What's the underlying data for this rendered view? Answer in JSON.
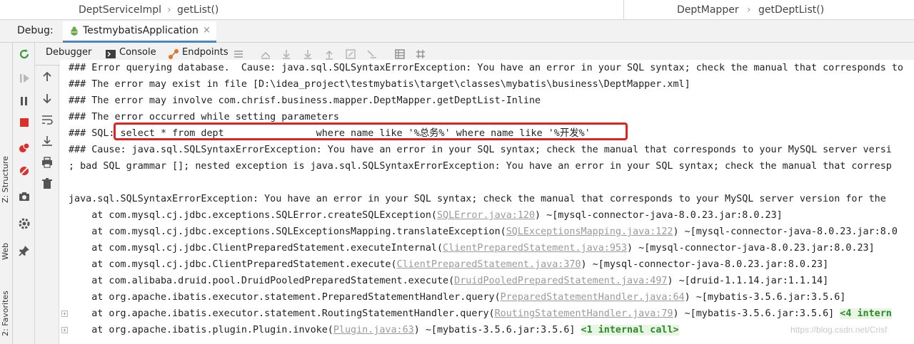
{
  "breadcrumbs": {
    "left": [
      "DeptServiceImpl",
      "getList()"
    ],
    "right": [
      "DeptMapper",
      "getDeptList()"
    ],
    "separator": "›"
  },
  "debug": {
    "label": "Debug:",
    "run_config": "TestmybatisApplication",
    "close_glyph": "×"
  },
  "side_labels": {
    "structure": "Z: Structure",
    "web": "Web",
    "favorites": "2: Favorites"
  },
  "toolbar": {
    "tabs": [
      "Debugger",
      "Console",
      "Endpoints"
    ],
    "icons": [
      "restore-layout-icon",
      "show-execution-point-icon",
      "step-over-icon",
      "step-into-icon",
      "force-step-into-icon",
      "step-out-icon",
      "drop-frame-icon",
      "run-to-cursor-icon",
      "evaluate-expression-icon",
      "trace-settings-icon"
    ]
  },
  "left_buttons": [
    "rerun-icon",
    "resume-icon",
    "pause-icon",
    "stop-icon",
    "view-breakpoints-icon",
    "mute-breakpoints-icon",
    "camera-icon",
    "settings-icon",
    "pin-icon"
  ],
  "tool_buttons": [
    "scroll-up-icon",
    "scroll-down-icon",
    "soft-wrap-icon",
    "scroll-to-end-icon",
    "print-icon",
    "clear-icon"
  ],
  "console": {
    "lines": [
      {
        "text": "### Error querying database.  Cause: java.sql.SQLSyntaxErrorException: You have an error in your SQL syntax; check the manual that corresponds to"
      },
      {
        "text": "### The error may exist in file [D:\\idea_project\\testmybatis\\target\\classes\\mybatis\\business\\DeptMapper.xml]"
      },
      {
        "text": "### The error may involve com.chrisf.business.mapper.DeptMapper.getDeptList-Inline"
      },
      {
        "text": "### The error occurred while setting parameters"
      },
      {
        "text": "### SQL: select * from dept                where name like '%总务%' where name like '%开发%'"
      },
      {
        "text": "### Cause: java.sql.SQLSyntaxErrorException: You have an error in your SQL syntax; check the manual that corresponds to your MySQL server versi"
      },
      {
        "text": "; bad SQL grammar []; nested exception is java.sql.SQLSyntaxErrorException: You have an error in your SQL syntax; check the manual that corresp"
      },
      {
        "text": ""
      },
      {
        "text": "java.sql.SQLSyntaxErrorException: You have an error in your SQL syntax; check the manual that corresponds to your MySQL server version for the"
      },
      {
        "pre": "    at com.mysql.cj.jdbc.exceptions.SQLError.createSQLException(",
        "link": "SQLError.java:120",
        "post": ") ~[mysql-connector-java-8.0.23.jar:8.0.23]"
      },
      {
        "pre": "    at com.mysql.cj.jdbc.exceptions.SQLExceptionsMapping.translateException(",
        "link": "SQLExceptionsMapping.java:122",
        "post": ") ~[mysql-connector-java-8.0.23.jar:8.0"
      },
      {
        "pre": "    at com.mysql.cj.jdbc.ClientPreparedStatement.executeInternal(",
        "link": "ClientPreparedStatement.java:953",
        "post": ") ~[mysql-connector-java-8.0.23.jar:8.0.23]"
      },
      {
        "pre": "    at com.mysql.cj.jdbc.ClientPreparedStatement.execute(",
        "link": "ClientPreparedStatement.java:370",
        "post": ") ~[mysql-connector-java-8.0.23.jar:8.0.23]"
      },
      {
        "pre": "    at com.alibaba.druid.pool.DruidPooledPreparedStatement.execute(",
        "link": "DruidPooledPreparedStatement.java:497",
        "post": ") ~[druid-1.1.14.jar:1.1.14]"
      },
      {
        "pre": "    at org.apache.ibatis.executor.statement.PreparedStatementHandler.query(",
        "link": "PreparedStatementHandler.java:64",
        "post": ") ~[mybatis-3.5.6.jar:3.5.6]"
      },
      {
        "pre": "    at org.apache.ibatis.executor.statement.RoutingStatementHandler.query(",
        "link": "RoutingStatementHandler.java:79",
        "post": ") ~[mybatis-3.5.6.jar:3.5.6] ",
        "badge": "<4 intern"
      },
      {
        "pre": "    at org.apache.ibatis.plugin.Plugin.invoke(",
        "link": "Plugin.java:63",
        "post": ") ~[mybatis-3.5.6.jar:3.5.6] ",
        "badge": "<1 internal call>"
      }
    ]
  },
  "watermark": "https://blog.csdn.net/Crisf",
  "colors": {
    "highlight_box": "#e0231e",
    "link": "#9a9a9a",
    "internal_call": "#2b8a2b"
  }
}
